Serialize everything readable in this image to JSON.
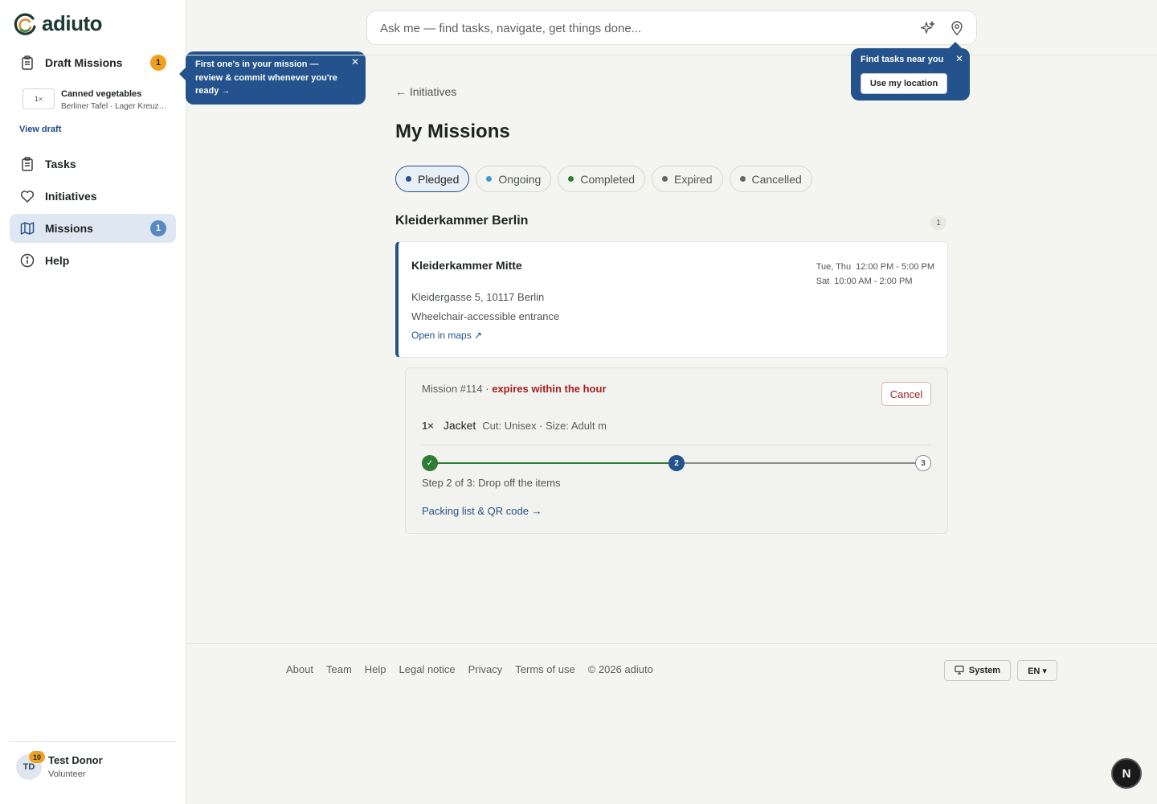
{
  "app": {
    "name": "adiuto"
  },
  "sidebar": {
    "draft": {
      "label": "Draft Missions",
      "badge": "1",
      "icon": "clipboard-icon"
    },
    "draft_item": {
      "qty": "1×",
      "name": "Canned vegetables",
      "sub": "Berliner Tafel · Lager Kreuzberg"
    },
    "view_draft": "View draft",
    "items": [
      {
        "label": "Tasks",
        "icon": "clipboard-icon"
      },
      {
        "label": "Initiatives",
        "icon": "heart-icon"
      },
      {
        "label": "Missions",
        "icon": "map-icon",
        "badge": "1",
        "active": true
      },
      {
        "label": "Help",
        "icon": "info-icon"
      }
    ],
    "user": {
      "initials": "TD",
      "points": "10",
      "name": "Test Donor",
      "role": "Volunteer"
    }
  },
  "tooltips": {
    "draft": "First one's in your mission — review & commit whenever you're ready →",
    "location": {
      "title": "Find tasks near you",
      "button": "Use my location"
    }
  },
  "search": {
    "placeholder": "Ask me — find tasks, navigate, get things done..."
  },
  "main": {
    "back": "← Initiatives",
    "title": "My Missions",
    "filters": [
      {
        "label": "Pledged",
        "color": "#23528d",
        "active": true
      },
      {
        "label": "Ongoing",
        "color": "#3a9ad9"
      },
      {
        "label": "Completed",
        "color": "#2e7d32"
      },
      {
        "label": "Expired",
        "color": "#666666"
      },
      {
        "label": "Cancelled",
        "color": "#666666"
      }
    ],
    "org": {
      "name": "Kleiderkammer Berlin",
      "count": "1"
    },
    "location": {
      "name": "Kleiderkammer Mitte",
      "hours": [
        {
          "days": "Tue, Thu",
          "time": "12:00 PM - 5:00 PM"
        },
        {
          "days": "Sat",
          "time": "10:00 AM - 2:00 PM"
        }
      ],
      "address": "Kleidergasse 5, 10117 Berlin",
      "accessibility": "Wheelchair-accessible entrance",
      "maps_link": "Open in maps ↗"
    },
    "mission": {
      "id_text": "Mission #114 ·",
      "expiry": "expires within the hour",
      "cancel": "Cancel",
      "item": {
        "qty": "1×",
        "name": "Jacket",
        "attrs": "Cut: Unisex · Size: Adult m"
      },
      "steps": {
        "current": 2,
        "total": 3,
        "done_mark": "✓",
        "labels": [
          "✓",
          "2",
          "3"
        ]
      },
      "step_text": "Step 2 of 3: Drop off the items",
      "packing_link": "Packing list & QR code →"
    }
  },
  "footer": {
    "links": [
      "About",
      "Team",
      "Help",
      "Legal notice",
      "Privacy",
      "Terms of use"
    ],
    "copyright": "© 2026 adiuto",
    "theme": "System",
    "lang": "EN ▾"
  },
  "fab": "N",
  "colors": {
    "accent": "#23528d",
    "warning": "#f0a020",
    "danger": "#a51f1f",
    "success": "#2e7d32"
  }
}
